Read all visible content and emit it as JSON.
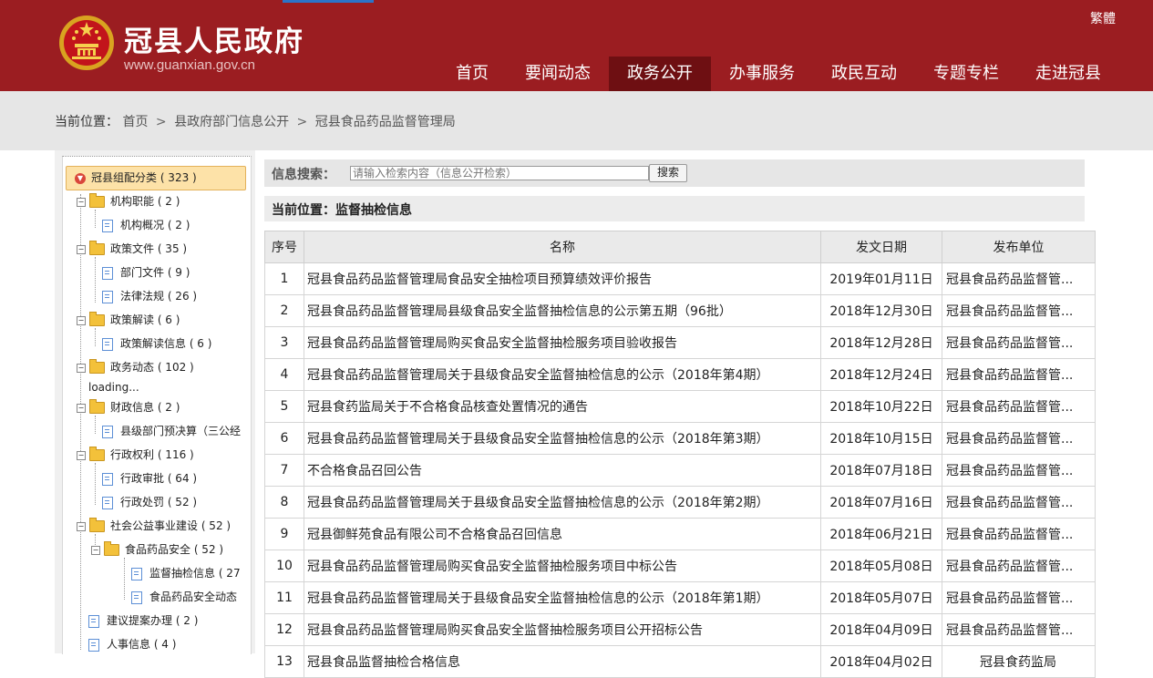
{
  "header": {
    "site_title": "冠县人民政府",
    "site_url": "www.guanxian.gov.cn",
    "lang_switch": "繁體",
    "nav": [
      {
        "label": "首页"
      },
      {
        "label": "要闻动态"
      },
      {
        "label": "政务公开",
        "active": true
      },
      {
        "label": "办事服务"
      },
      {
        "label": "政民互动"
      },
      {
        "label": "专题专栏"
      },
      {
        "label": "走进冠县"
      }
    ],
    "brand_color": "#9b1d21"
  },
  "breadcrumb": {
    "label": "当前位置：",
    "items": [
      "首页",
      "县政府部门信息公开",
      "冠县食品药品监督管理局"
    ],
    "separator": ">"
  },
  "sidebar": {
    "root": "冠县组配分类 ( 323 )",
    "items": [
      {
        "label": "机构职能 ( 2 )"
      },
      {
        "label": "机构概况 ( 2 )"
      },
      {
        "label": "政策文件 ( 35 )"
      },
      {
        "label": "部门文件 ( 9 )"
      },
      {
        "label": "法律法规 ( 26 )"
      },
      {
        "label": "政策解读 ( 6 )"
      },
      {
        "label": "政策解读信息 ( 6 )"
      },
      {
        "label": "政务动态 ( 102 )"
      },
      {
        "label": "loading..."
      },
      {
        "label": "财政信息 ( 2 )"
      },
      {
        "label": "县级部门预决算（三公经"
      },
      {
        "label": "行政权利 ( 116 )"
      },
      {
        "label": "行政审批 ( 64 )"
      },
      {
        "label": "行政处罚 ( 52 )"
      },
      {
        "label": "社会公益事业建设 ( 52 )"
      },
      {
        "label": "食品药品安全 ( 52 )"
      },
      {
        "label": "监督抽检信息 ( 27"
      },
      {
        "label": "食品药品安全动态"
      },
      {
        "label": "建议提案办理 ( 2 )"
      },
      {
        "label": "人事信息 ( 4 )"
      }
    ]
  },
  "search": {
    "label": "信息搜索：",
    "placeholder": "请输入检索内容（信息公开检索）",
    "button": "搜索"
  },
  "current_position": "当前位置：监督抽检信息",
  "table": {
    "headers": [
      "序号",
      "名称",
      "发文日期",
      "发布单位"
    ],
    "rows": [
      {
        "idx": "1",
        "name": "冠县食品药品监督管理局食品安全抽检项目预算绩效评价报告",
        "date": "2019年01月11日",
        "unit": "冠县食品药品监督管..."
      },
      {
        "idx": "2",
        "name": "冠县食品药品监督管理局县级食品安全监督抽检信息的公示第五期（96批）",
        "date": "2018年12月30日",
        "unit": "冠县食品药品监督管..."
      },
      {
        "idx": "3",
        "name": "冠县食品药品监督管理局购买食品安全监督抽检服务项目验收报告",
        "date": "2018年12月28日",
        "unit": "冠县食品药品监督管..."
      },
      {
        "idx": "4",
        "name": "冠县食品药品监督管理局关于县级食品安全监督抽检信息的公示（2018年第4期）",
        "date": "2018年12月24日",
        "unit": "冠县食品药品监督管..."
      },
      {
        "idx": "5",
        "name": "冠县食药监局关于不合格食品核查处置情况的通告",
        "date": "2018年10月22日",
        "unit": "冠县食品药品监督管..."
      },
      {
        "idx": "6",
        "name": "冠县食品药品监督管理局关于县级食品安全监督抽检信息的公示（2018年第3期）",
        "date": "2018年10月15日",
        "unit": "冠县食品药品监督管..."
      },
      {
        "idx": "7",
        "name": "不合格食品召回公告",
        "date": "2018年07月18日",
        "unit": "冠县食品药品监督管..."
      },
      {
        "idx": "8",
        "name": "冠县食品药品监督管理局关于县级食品安全监督抽检信息的公示（2018年第2期）",
        "date": "2018年07月16日",
        "unit": "冠县食品药品监督管..."
      },
      {
        "idx": "9",
        "name": "冠县御鲜苑食品有限公司不合格食品召回信息",
        "date": "2018年06月21日",
        "unit": "冠县食品药品监督管..."
      },
      {
        "idx": "10",
        "name": "冠县食品药品监督管理局购买食品安全监督抽检服务项目中标公告",
        "date": "2018年05月08日",
        "unit": "冠县食品药品监督管..."
      },
      {
        "idx": "11",
        "name": "冠县食品药品监督管理局关于县级食品安全监督抽检信息的公示（2018年第1期）",
        "date": "2018年05月07日",
        "unit": "冠县食品药品监督管..."
      },
      {
        "idx": "12",
        "name": "冠县食品药品监督管理局购买食品安全监督抽检服务项目公开招标公告",
        "date": "2018年04月09日",
        "unit": "冠县食品药品监督管..."
      },
      {
        "idx": "13",
        "name": "冠县食品监督抽检合格信息",
        "date": "2018年04月02日",
        "unit": "冠县食药监局"
      }
    ]
  }
}
